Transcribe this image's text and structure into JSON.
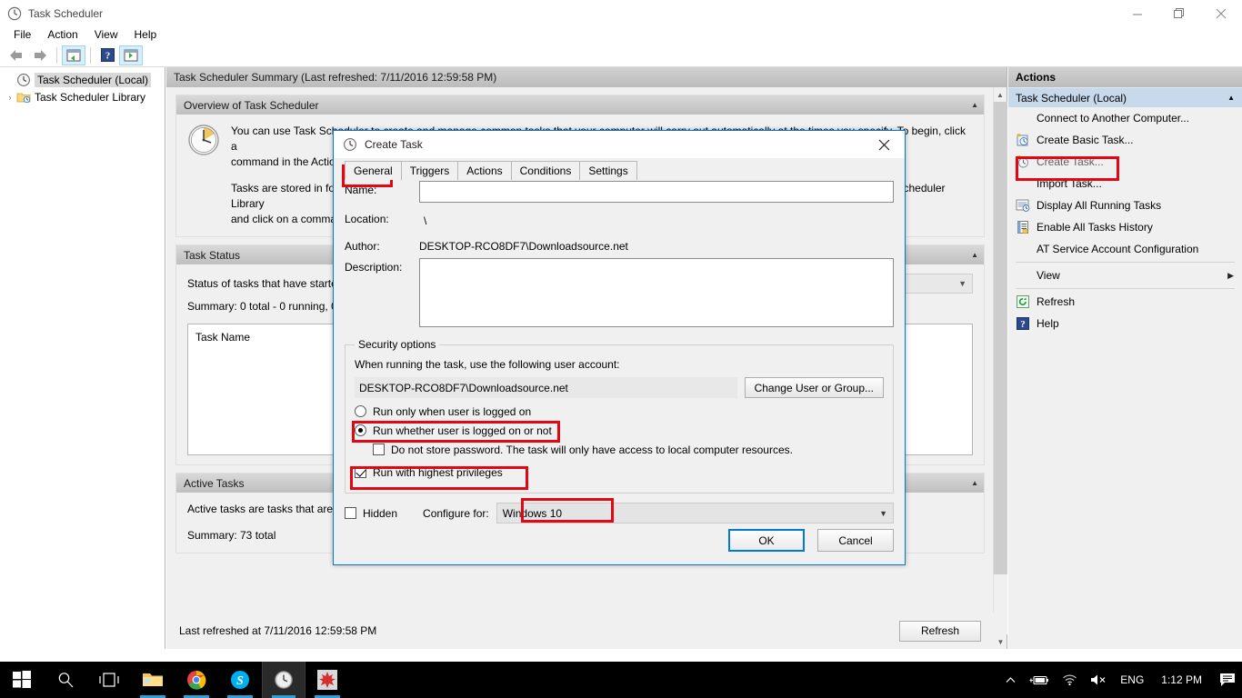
{
  "window": {
    "title": "Task Scheduler",
    "icon": "clock-icon",
    "controls": {
      "minimize": "minimize-icon",
      "maximize": "maximize-icon",
      "close": "close-icon"
    }
  },
  "menubar": {
    "items": [
      "File",
      "Action",
      "View",
      "Help"
    ]
  },
  "toolbar": {
    "items": [
      {
        "name": "back-arrow-icon"
      },
      {
        "name": "forward-arrow-icon"
      },
      {
        "name": "show-hide-console-tree-icon"
      },
      {
        "name": "help-icon"
      },
      {
        "name": "show-hide-action-pane-icon"
      }
    ]
  },
  "tree": {
    "nodes": [
      {
        "label": "Task Scheduler (Local)",
        "icon": "clock-icon",
        "selected": true,
        "expander": ""
      },
      {
        "label": "Task Scheduler Library",
        "icon": "folder-clock-icon",
        "selected": false,
        "expander": "›"
      }
    ]
  },
  "center": {
    "header": "Task Scheduler Summary (Last refreshed: 7/11/2016 12:59:58 PM)",
    "panels": [
      {
        "title": "Overview of Task Scheduler",
        "icon": "clock-large-icon",
        "lines": [
          "You can use Task Scheduler to create and manage common tasks that your computer will carry out automatically at the times you specify. To begin, click a",
          "command in the Action menu.",
          "",
          "Tasks are stored in folders in the Task Scheduler Library. To view or perform an operation on an individual task, select the task in the Task Scheduler Library",
          "and click on a command in the Action menu."
        ]
      },
      {
        "title": "Task Status",
        "lines": [
          "Status of tasks that have started in the following time period:",
          "Summary: 0 total - 0 running, 0 succeeded, 0 stopped, 0 failed"
        ],
        "dropdown_value": "",
        "table_header": "Task Name"
      },
      {
        "title": "Active Tasks",
        "lines": [
          "Active tasks are tasks that are currently enabled and have not expired.",
          "Summary: 73 total"
        ]
      }
    ],
    "footer": {
      "status": "Last refreshed at 7/11/2016 12:59:58 PM",
      "refresh_label": "Refresh"
    }
  },
  "actions": {
    "header": "Actions",
    "group": "Task Scheduler (Local)",
    "group_chevron": "▲",
    "items": [
      {
        "label": "Connect to Another Computer...",
        "icon": null,
        "dim": false,
        "submenu": false,
        "highlighted": false
      },
      {
        "label": "Create Basic Task...",
        "icon": "create-basic-task-icon",
        "dim": false,
        "submenu": false,
        "highlighted": false
      },
      {
        "label": "Create Task...",
        "icon": "create-task-icon",
        "dim": true,
        "submenu": false,
        "highlighted": true
      },
      {
        "label": "Import Task...",
        "icon": null,
        "dim": false,
        "submenu": false,
        "highlighted": false
      },
      {
        "label": "Display All Running Tasks",
        "icon": "running-tasks-icon",
        "dim": false,
        "submenu": false,
        "highlighted": false
      },
      {
        "label": "Enable All Tasks History",
        "icon": "history-icon",
        "dim": false,
        "submenu": false,
        "highlighted": false
      },
      {
        "label": "AT Service Account Configuration",
        "icon": null,
        "dim": false,
        "submenu": false,
        "highlighted": false
      },
      {
        "label": "View",
        "icon": null,
        "dim": false,
        "submenu": true,
        "highlighted": false
      },
      {
        "label": "Refresh",
        "icon": "refresh-icon",
        "dim": false,
        "submenu": false,
        "highlighted": false
      },
      {
        "label": "Help",
        "icon": "help-icon",
        "dim": false,
        "submenu": false,
        "highlighted": false
      }
    ]
  },
  "dialog": {
    "title": "Create Task",
    "icon": "clock-icon",
    "close": "close-icon",
    "tabs": [
      {
        "label": "General",
        "active": true
      },
      {
        "label": "Triggers",
        "active": false
      },
      {
        "label": "Actions",
        "active": false
      },
      {
        "label": "Conditions",
        "active": false
      },
      {
        "label": "Settings",
        "active": false
      }
    ],
    "fields": {
      "name_label": "Name:",
      "name_value": "",
      "location_label": "Location:",
      "location_value": "\\",
      "author_label": "Author:",
      "author_value": "DESKTOP-RCO8DF7\\Downloadsource.net",
      "description_label": "Description:",
      "description_value": ""
    },
    "security": {
      "legend": "Security options",
      "account_prompt": "When running the task, use the following user account:",
      "account_value": "DESKTOP-RCO8DF7\\Downloadsource.net",
      "change_user_label": "Change User or Group...",
      "radio_logged_on": {
        "label": "Run only when user is logged on",
        "checked": false
      },
      "radio_whether": {
        "label": "Run whether user is logged on or not",
        "checked": true
      },
      "checkbox_no_password": {
        "label": "Do not store password.  The task will only have access to local computer resources.",
        "checked": false
      },
      "checkbox_highest": {
        "label": "Run with highest privileges",
        "checked": true
      }
    },
    "bottom": {
      "hidden_label": "Hidden",
      "hidden_checked": false,
      "configure_label": "Configure for:",
      "configure_value": "Windows 10"
    },
    "buttons": {
      "ok": "OK",
      "cancel": "Cancel"
    }
  },
  "taskbar": {
    "items": [
      {
        "name": "start-button-icon",
        "running": false
      },
      {
        "name": "search-icon",
        "running": false
      },
      {
        "name": "task-view-icon",
        "running": false
      },
      {
        "name": "file-explorer-icon",
        "running": true
      },
      {
        "name": "chrome-icon",
        "running": true
      },
      {
        "name": "skype-icon",
        "running": true
      },
      {
        "name": "task-scheduler-icon",
        "running": true,
        "active": true
      },
      {
        "name": "maple-app-icon",
        "running": true
      }
    ],
    "tray": {
      "chevron": "show-hidden-icons-icon",
      "battery": "battery-charging-icon",
      "network": "wifi-icon",
      "volume": "volume-muted-icon",
      "language": "ENG",
      "time": "1:12 PM",
      "notifications": "action-center-icon"
    }
  },
  "highlights": {
    "color": "#e30613",
    "boxes": [
      "create-task-action",
      "general-tab",
      "run-whether-radio",
      "run-highest-checkbox",
      "configure-for-value"
    ]
  }
}
